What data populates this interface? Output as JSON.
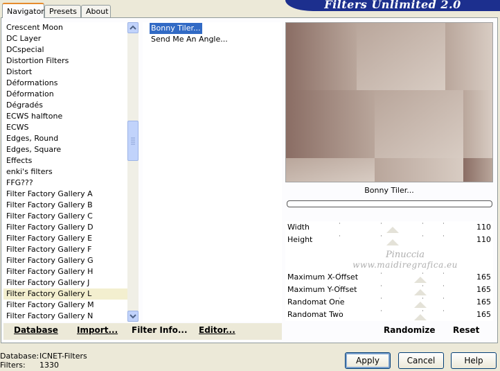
{
  "tabs": [
    {
      "label": "Navigator",
      "active": true
    },
    {
      "label": "Presets",
      "active": false
    },
    {
      "label": "About",
      "active": false
    }
  ],
  "app_title": "Filters Unlimited 2.0",
  "categories": [
    "Crescent Moon",
    "DC Layer",
    "DCspecial",
    "Distortion Filters",
    "Distort",
    "Déformations",
    "Déformation",
    "Dégradés",
    "ECWS halftone",
    "ECWS",
    "Edges, Round",
    "Edges, Square",
    "Effects",
    "enki's filters",
    "FFG???",
    "Filter Factory Gallery A",
    "Filter Factory Gallery B",
    "Filter Factory Gallery C",
    "Filter Factory Gallery D",
    "Filter Factory Gallery E",
    "Filter Factory Gallery F",
    "Filter Factory Gallery G",
    "Filter Factory Gallery H",
    "Filter Factory Gallery J",
    "Filter Factory Gallery L",
    "Filter Factory Gallery M",
    "Filter Factory Gallery N"
  ],
  "selected_category_index": 24,
  "filters": [
    "Bonny Tiler...",
    "Send Me An Angle..."
  ],
  "selected_filter_index": 0,
  "preview": {
    "filter_name": "Bonny Tiler...",
    "colors": {
      "dark": "#8a6d64",
      "mid": "#b9a69b",
      "light": "#d8ccc3"
    }
  },
  "watermark": {
    "line1": "Pinuccia",
    "line2": "www.maidiregrafica.eu"
  },
  "params": [
    {
      "label": "Width",
      "value": "110",
      "level": 0.43
    },
    {
      "label": "Height",
      "value": "110",
      "level": 0.43
    },
    {
      "label": "",
      "value": "",
      "level": null
    },
    {
      "label": "Maximum X-Offset",
      "value": "165",
      "level": 0.65
    },
    {
      "label": "Maximum Y-Offset",
      "value": "165",
      "level": 0.65
    },
    {
      "label": "Randomat One",
      "value": "165",
      "level": 0.65
    },
    {
      "label": "Randomat Two",
      "value": "165",
      "level": 0.65
    }
  ],
  "toolbar": {
    "database": "Database",
    "import": "Import...",
    "filter_info": "Filter Info...",
    "editor": "Editor...",
    "randomize": "Randomize",
    "reset": "Reset"
  },
  "status": {
    "database_label": "Database:",
    "database_value": "ICNET-Filters",
    "filters_label": "Filters:",
    "filters_value": "1330"
  },
  "buttons": {
    "apply": "Apply",
    "cancel": "Cancel",
    "help": "Help"
  }
}
